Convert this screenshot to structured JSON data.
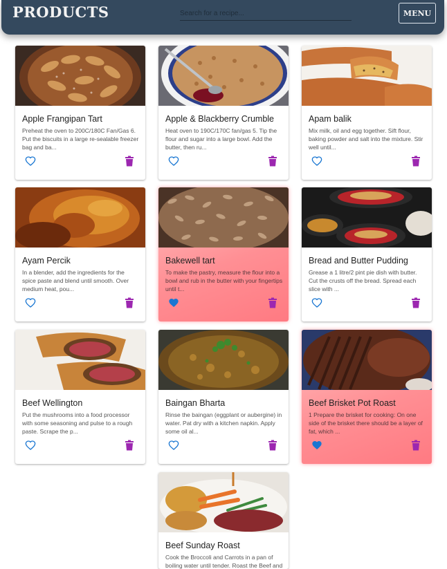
{
  "header": {
    "brand": "PRODUCTS",
    "search_placeholder": "Search for a recipe...",
    "menu_label": "MENU"
  },
  "colors": {
    "header_bg": "#34495e",
    "favorite_heart": "#1976d2",
    "heart_outline": "#1976d2",
    "trash": "#9c27b0",
    "favorite_card": "#ff8f94"
  },
  "recipes": [
    {
      "title": "Apple Frangipan Tart",
      "description": "Preheat the oven to 200C/180C Fan/Gas 6. Put the biscuits in a large re-sealable freezer bag and ba...",
      "favorite": false
    },
    {
      "title": "Apple & Blackberry Crumble",
      "description": "Heat oven to 190C/170C fan/gas 5. Tip the flour and sugar into a large bowl. Add the butter, then ru...",
      "favorite": false
    },
    {
      "title": "Apam balik",
      "description": "Mix milk, oil and egg together. Sift flour, baking powder and salt into the mixture. Stir well until...",
      "favorite": false
    },
    {
      "title": "Ayam Percik",
      "description": "In a blender, add the ingredients for the spice paste and blend until smooth. Over medium heat, pou...",
      "favorite": false
    },
    {
      "title": "Bakewell tart",
      "description": "To make the pastry, measure the flour into a bowl and rub in the butter with your fingertips until t...",
      "favorite": true
    },
    {
      "title": "Bread and Butter Pudding",
      "description": "Grease a 1 litre/2 pint pie dish with butter. Cut the crusts off the bread. Spread each slice with ...",
      "favorite": false
    },
    {
      "title": "Beef Wellington",
      "description": "Put the mushrooms into a food processor with some seasoning and pulse to a rough paste. Scrape the p...",
      "favorite": false
    },
    {
      "title": "Baingan Bharta",
      "description": "Rinse the baingan (eggplant or aubergine) in water. Pat dry with a kitchen napkin. Apply some oil al...",
      "favorite": false
    },
    {
      "title": "Beef Brisket Pot Roast",
      "description": "1 Prepare the brisket for cooking: On one side of the brisket there should be a layer of fat, which ...",
      "favorite": true
    },
    {
      "title": "Beef Sunday Roast",
      "description": "Cook the Broccoli and Carrots in a pan of boiling water until tender. Roast the Beef and Potatoes ...",
      "favorite": false
    }
  ]
}
